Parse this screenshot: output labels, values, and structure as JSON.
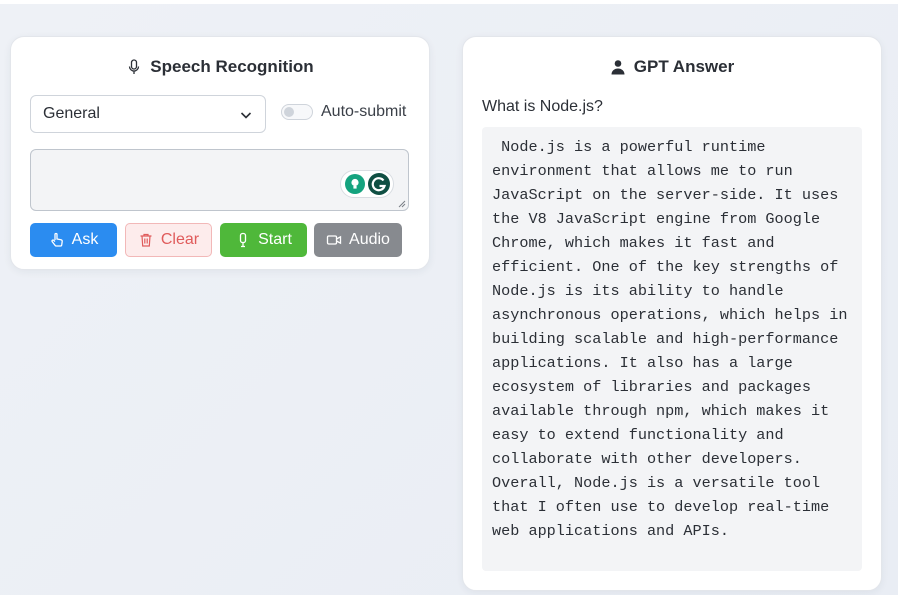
{
  "speech": {
    "title": "Speech Recognition",
    "title_icon": "microphone-icon",
    "mode_select": {
      "selected": "General"
    },
    "auto_submit_label": "Auto-submit",
    "auto_submit_on": false,
    "textarea_value": "",
    "buttons": {
      "ask": {
        "label": "Ask",
        "icon": "hand-pointer-icon"
      },
      "clear": {
        "label": "Clear",
        "icon": "trash-icon"
      },
      "start": {
        "label": "Start",
        "icon": "microphone-icon"
      },
      "audio": {
        "label": "Audio",
        "icon": "video-camera-icon"
      }
    }
  },
  "gpt": {
    "title": "GPT Answer",
    "title_icon": "user-icon",
    "question": "What is Node.js?",
    "answer": " Node.js is a powerful runtime environment that allows me to run JavaScript on the server-side. It uses the V8 JavaScript engine from Google Chrome, which makes it fast and efficient. One of the key strengths of Node.js is its ability to handle asynchronous operations, which helps in building scalable and high-performance applications. It also has a large ecosystem of libraries and packages available through npm, which makes it easy to extend functionality and collaborate with other developers. Overall, Node.js is a versatile tool that I often use to develop real-time web applications and APIs."
  },
  "colors": {
    "ask": "#2b8cf0",
    "clear_bg": "#fdecec",
    "clear_text": "#e05b5b",
    "start": "#4fb83a",
    "audio": "#878a8f",
    "grammarly": "#15a37f"
  }
}
